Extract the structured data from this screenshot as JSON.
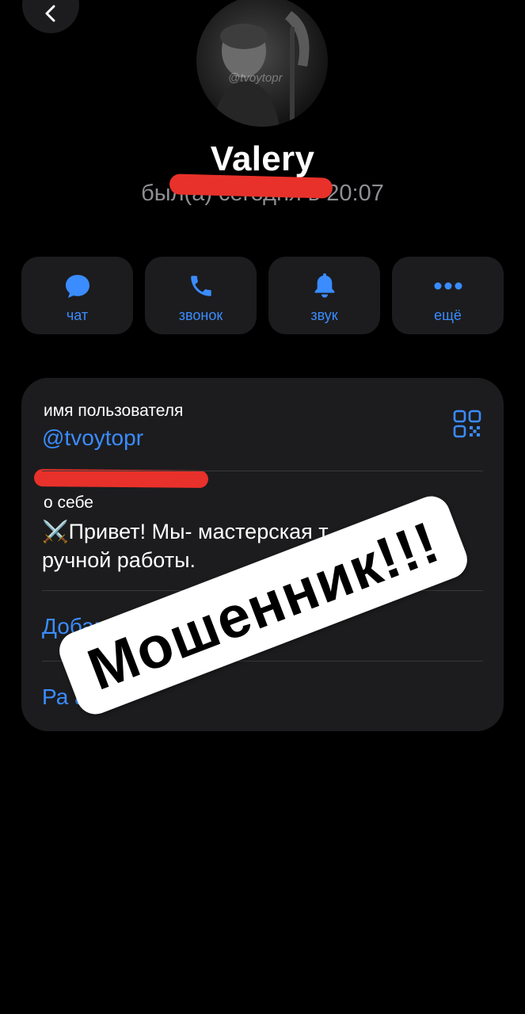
{
  "header": {
    "back_icon": "chevron-left-icon",
    "avatar_watermark": "@tvoytopr"
  },
  "profile": {
    "name": "Valery",
    "last_seen": "был(а) сегодня в 20:07"
  },
  "actions": [
    {
      "label": "чат",
      "icon": "chat-bubble-icon"
    },
    {
      "label": "звонок",
      "icon": "phone-icon"
    },
    {
      "label": "звук",
      "icon": "bell-icon"
    },
    {
      "label": "ещё",
      "icon": "more-dots-icon"
    }
  ],
  "info": {
    "username_caption": "имя пользователя",
    "username_value": "@tvoytopr",
    "qr_icon": "qr-code-icon",
    "bio_caption": "о себе",
    "bio_text": "⚔️Привет! Мы- мастерская т\nручной работы.",
    "add_label": "Добавить в",
    "share_label": "Ра   ать"
  },
  "overlay": {
    "scam_label": "Мошенник!!!"
  },
  "colors": {
    "background": "#000000",
    "card": "#1c1c1e",
    "accent": "#3a8cff",
    "secondary_text": "#8e8e93",
    "redaction": "#e8312a"
  }
}
